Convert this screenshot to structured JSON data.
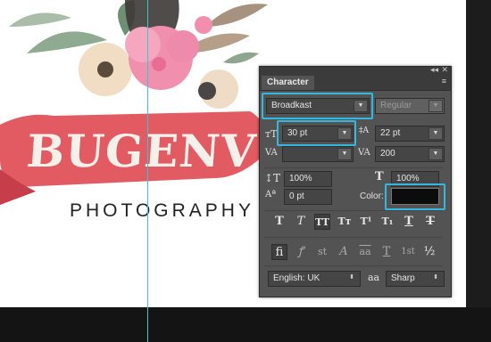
{
  "canvas": {
    "logo": "BUGENVIL",
    "tagline": "PHOTOGRAPHY"
  },
  "panel": {
    "tab": "Character",
    "collapse_icon": "◂◂",
    "close_icon": "✕",
    "menu_icon": "≡",
    "font_family": "Broadkast",
    "font_style": "Regular",
    "font_size": "30 pt",
    "leading": "22 pt",
    "kerning": "",
    "tracking": "200",
    "vertical_scale": "100%",
    "horizontal_scale": "100%",
    "baseline_shift": "0 pt",
    "color_label": "Color:",
    "color_value": "#0c0c0c",
    "language": "English: UK",
    "aa_icon": "aa",
    "antialias": "Sharp",
    "type_buttons": [
      "T",
      "T",
      "TT",
      "Tт",
      "T¹",
      "T₁",
      "T",
      "T"
    ],
    "opentype_buttons": [
      "fi",
      "ꝭ",
      "st",
      "A",
      "aa",
      "T",
      "1st",
      "½"
    ]
  },
  "colors": {
    "accent": "#35b8df",
    "guide": "#35c6d8",
    "panel_bg": "#535353"
  }
}
